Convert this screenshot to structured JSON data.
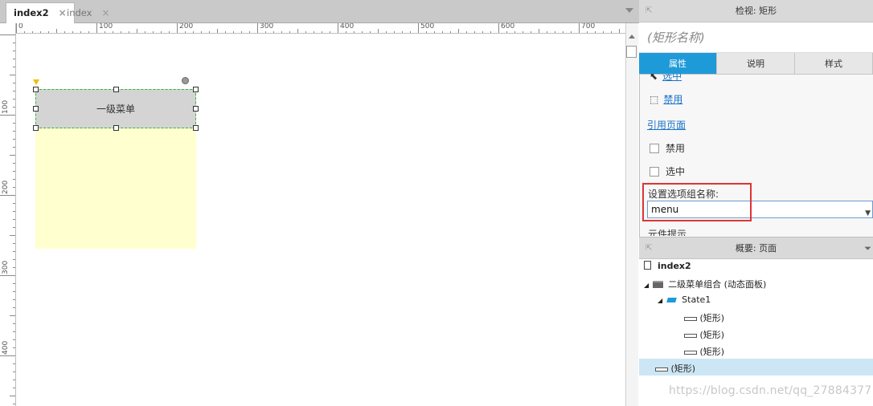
{
  "tabs": [
    {
      "label": "index2",
      "close": "×"
    },
    {
      "label": "index",
      "close": "×"
    }
  ],
  "ruler": {
    "h_labels": [
      "0",
      "100",
      "200",
      "300",
      "400",
      "500",
      "600",
      "700"
    ],
    "v_labels": [
      "100",
      "200",
      "300",
      "400"
    ]
  },
  "canvas": {
    "widget_label": "一级菜单"
  },
  "inspector": {
    "header": "检视: 矩形",
    "widget_name_placeholder": "(矩形名称)",
    "tabs": [
      "属性",
      "说明",
      "样式"
    ],
    "interactions": [
      {
        "label": "选中",
        "icon": "cursor-icon"
      },
      {
        "label": "禁用",
        "icon": "disabled-cursor-icon"
      }
    ],
    "ref_page_link": "引用页面",
    "checkboxes": [
      {
        "label": "禁用",
        "checked": false
      },
      {
        "label": "选中",
        "checked": false
      }
    ],
    "group_label": "设置选项组名称:",
    "group_value": "menu",
    "tooltip_label": "元件提示"
  },
  "outline": {
    "header": "概要: 页面",
    "items": [
      {
        "label": "index2",
        "level": 0,
        "icon": "page-icon"
      },
      {
        "label": "二级菜单组合 (动态面板)",
        "level": 0,
        "icon": "dynamic-panel-icon"
      },
      {
        "label": "State1",
        "level": 1,
        "icon": "state-icon"
      },
      {
        "label": "(矩形)",
        "level": 2,
        "icon": "rectangle-icon"
      },
      {
        "label": "(矩形)",
        "level": 2,
        "icon": "rectangle-icon"
      },
      {
        "label": "(矩形)",
        "level": 2,
        "icon": "rectangle-icon"
      },
      {
        "label": "(矩形)",
        "level": 0,
        "icon": "rectangle-icon",
        "selected": true
      }
    ]
  },
  "watermark": "https://blog.csdn.net/qq_27884377",
  "colors": {
    "accent": "#1f9ad8",
    "highlight": "#e03434",
    "selection": "#cde6f5"
  }
}
